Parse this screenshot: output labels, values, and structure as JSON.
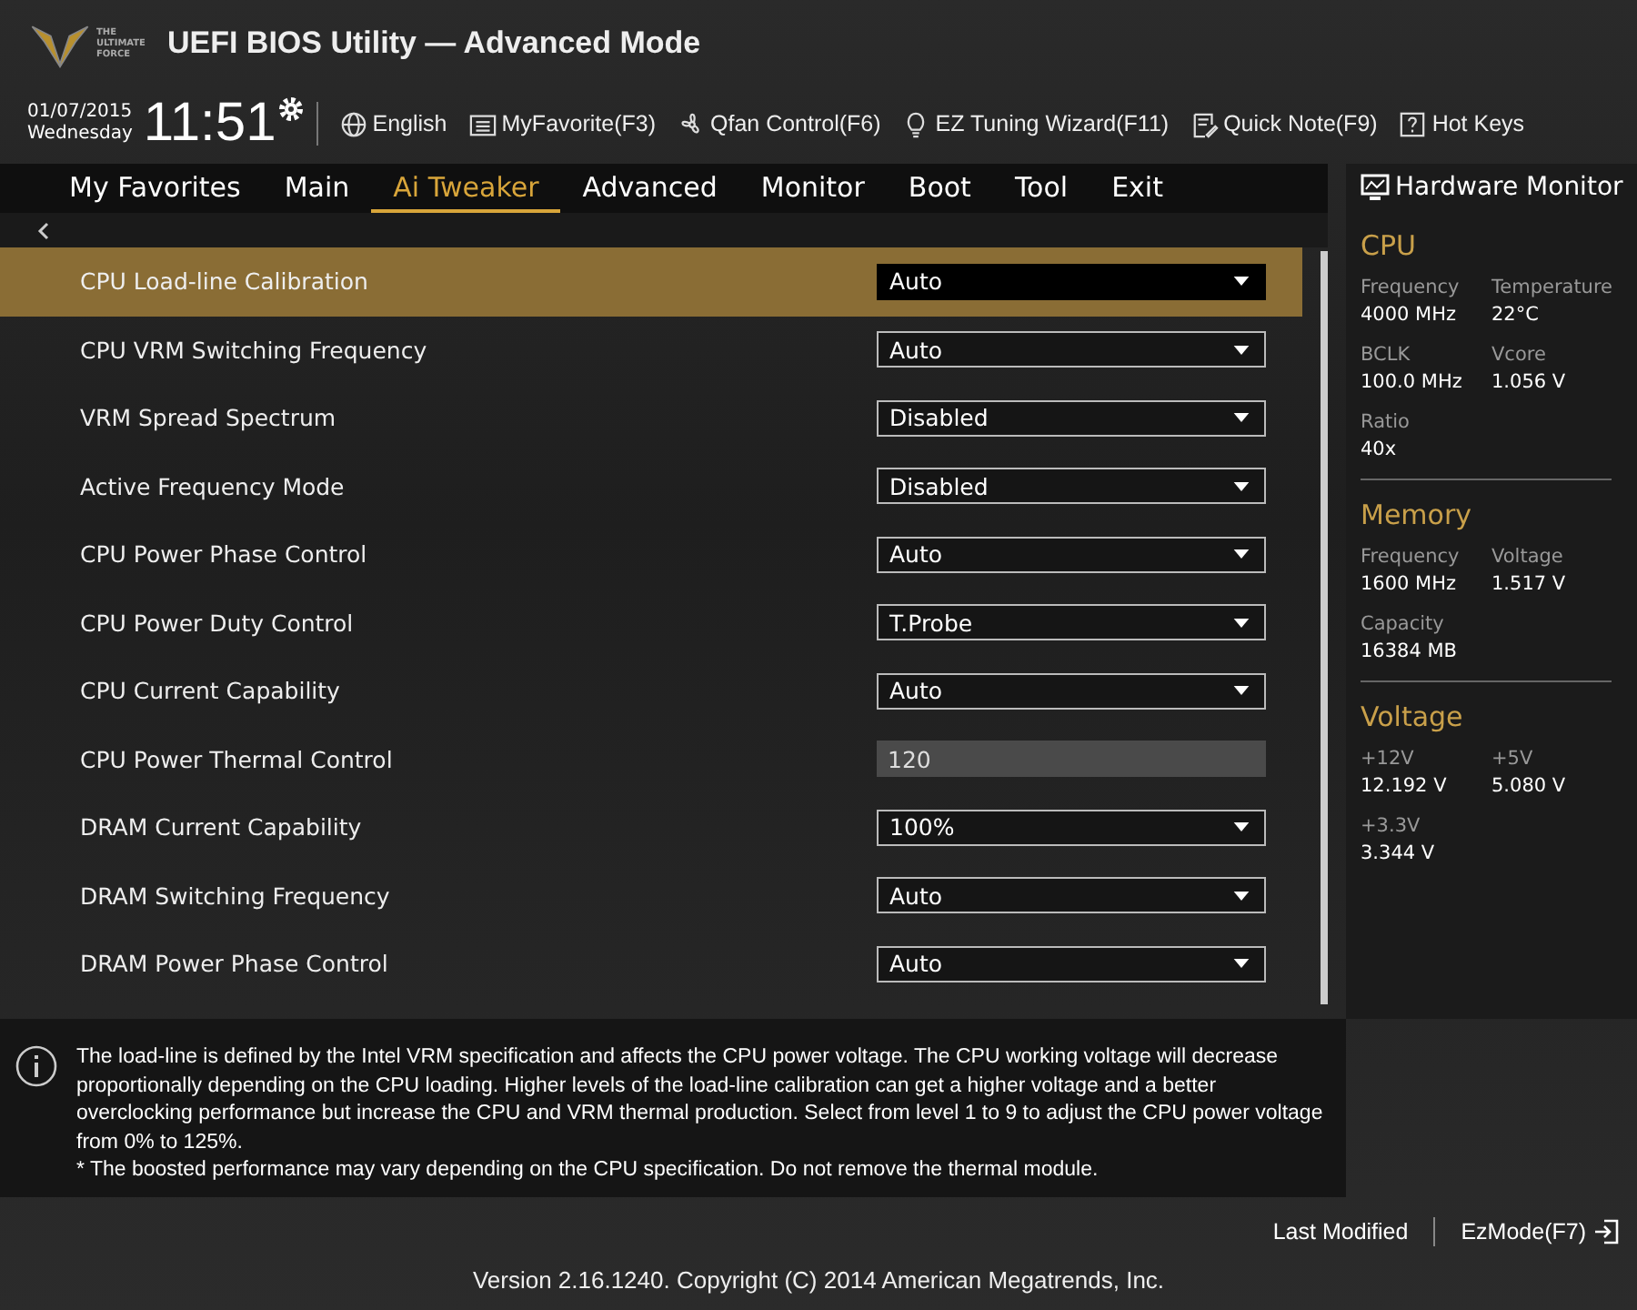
{
  "window": {
    "title": "UEFI BIOS Utility — Advanced Mode"
  },
  "logo": {
    "lines": [
      "THE",
      "ULTIMATE",
      "FORCE"
    ]
  },
  "clock": {
    "date": "01/07/2015",
    "day": "Wednesday",
    "time": "11:51"
  },
  "toolbar": [
    {
      "kind": "globe",
      "label": "English"
    },
    {
      "kind": "favorite",
      "label": "MyFavorite(F3)"
    },
    {
      "kind": "fan",
      "label": "Qfan Control(F6)"
    },
    {
      "kind": "bulb",
      "label": "EZ Tuning Wizard(F11)"
    },
    {
      "kind": "note",
      "label": "Quick Note(F9)"
    },
    {
      "kind": "help",
      "label": "Hot Keys"
    }
  ],
  "tabs": [
    {
      "label": "My Favorites",
      "selected": false
    },
    {
      "label": "Main",
      "selected": false
    },
    {
      "label": "Ai Tweaker",
      "selected": true
    },
    {
      "label": "Advanced",
      "selected": false
    },
    {
      "label": "Monitor",
      "selected": false
    },
    {
      "label": "Boot",
      "selected": false
    },
    {
      "label": "Tool",
      "selected": false
    },
    {
      "label": "Exit",
      "selected": false
    }
  ],
  "settings": [
    {
      "name": "CPU Load-line Calibration",
      "kind": "dropdown",
      "value": "Auto",
      "selected": true
    },
    {
      "name": "CPU VRM Switching Frequency",
      "kind": "dropdown",
      "value": "Auto",
      "selected": false
    },
    {
      "name": "VRM Spread Spectrum",
      "kind": "dropdown",
      "value": "Disabled",
      "selected": false
    },
    {
      "name": "Active Frequency Mode",
      "kind": "dropdown",
      "value": "Disabled",
      "selected": false
    },
    {
      "name": "CPU Power Phase Control",
      "kind": "dropdown",
      "value": "Auto",
      "selected": false
    },
    {
      "name": "CPU Power Duty Control",
      "kind": "dropdown",
      "value": "T.Probe",
      "selected": false
    },
    {
      "name": "CPU Current Capability",
      "kind": "dropdown",
      "value": "Auto",
      "selected": false
    },
    {
      "name": "CPU Power Thermal Control",
      "kind": "input",
      "value": "120",
      "selected": false
    },
    {
      "name": "DRAM Current Capability",
      "kind": "dropdown",
      "value": "100%",
      "selected": false
    },
    {
      "name": "DRAM Switching Frequency",
      "kind": "dropdown",
      "value": "Auto",
      "selected": false
    },
    {
      "name": "DRAM Power Phase Control",
      "kind": "dropdown",
      "value": "Auto",
      "selected": false
    }
  ],
  "help": {
    "text": "The load-line is defined by the Intel VRM specification and affects the CPU power voltage. The CPU working voltage will decrease proportionally depending on the CPU loading. Higher levels of the load-line calibration can get a higher voltage and a better overclocking performance but increase the CPU and VRM thermal production. Select from level 1 to 9 to adjust the CPU power voltage from 0% to 125%.",
    "note": "* The boosted performance may vary depending on the CPU specification. Do not remove the thermal module."
  },
  "hardware_monitor": {
    "title": "Hardware Monitor",
    "sections": [
      {
        "title": "CPU",
        "items": [
          {
            "label": "Frequency",
            "value": "4000 MHz"
          },
          {
            "label": "Temperature",
            "value": "22°C"
          },
          {
            "label": "BCLK",
            "value": "100.0 MHz"
          },
          {
            "label": "Vcore",
            "value": "1.056 V"
          },
          {
            "label": "Ratio",
            "value": "40x"
          }
        ]
      },
      {
        "title": "Memory",
        "items": [
          {
            "label": "Frequency",
            "value": "1600 MHz"
          },
          {
            "label": "Voltage",
            "value": "1.517 V"
          },
          {
            "label": "Capacity",
            "value": "16384 MB"
          }
        ]
      },
      {
        "title": "Voltage",
        "items": [
          {
            "label": "+12V",
            "value": "12.192 V"
          },
          {
            "label": "+5V",
            "value": "5.080 V"
          },
          {
            "label": "+3.3V",
            "value": "3.344 V"
          }
        ]
      }
    ]
  },
  "footer": {
    "last_modified": "Last Modified",
    "ezmode": "EzMode(F7)",
    "version": "Version 2.16.1240. Copyright (C) 2014 American Megatrends, Inc."
  }
}
